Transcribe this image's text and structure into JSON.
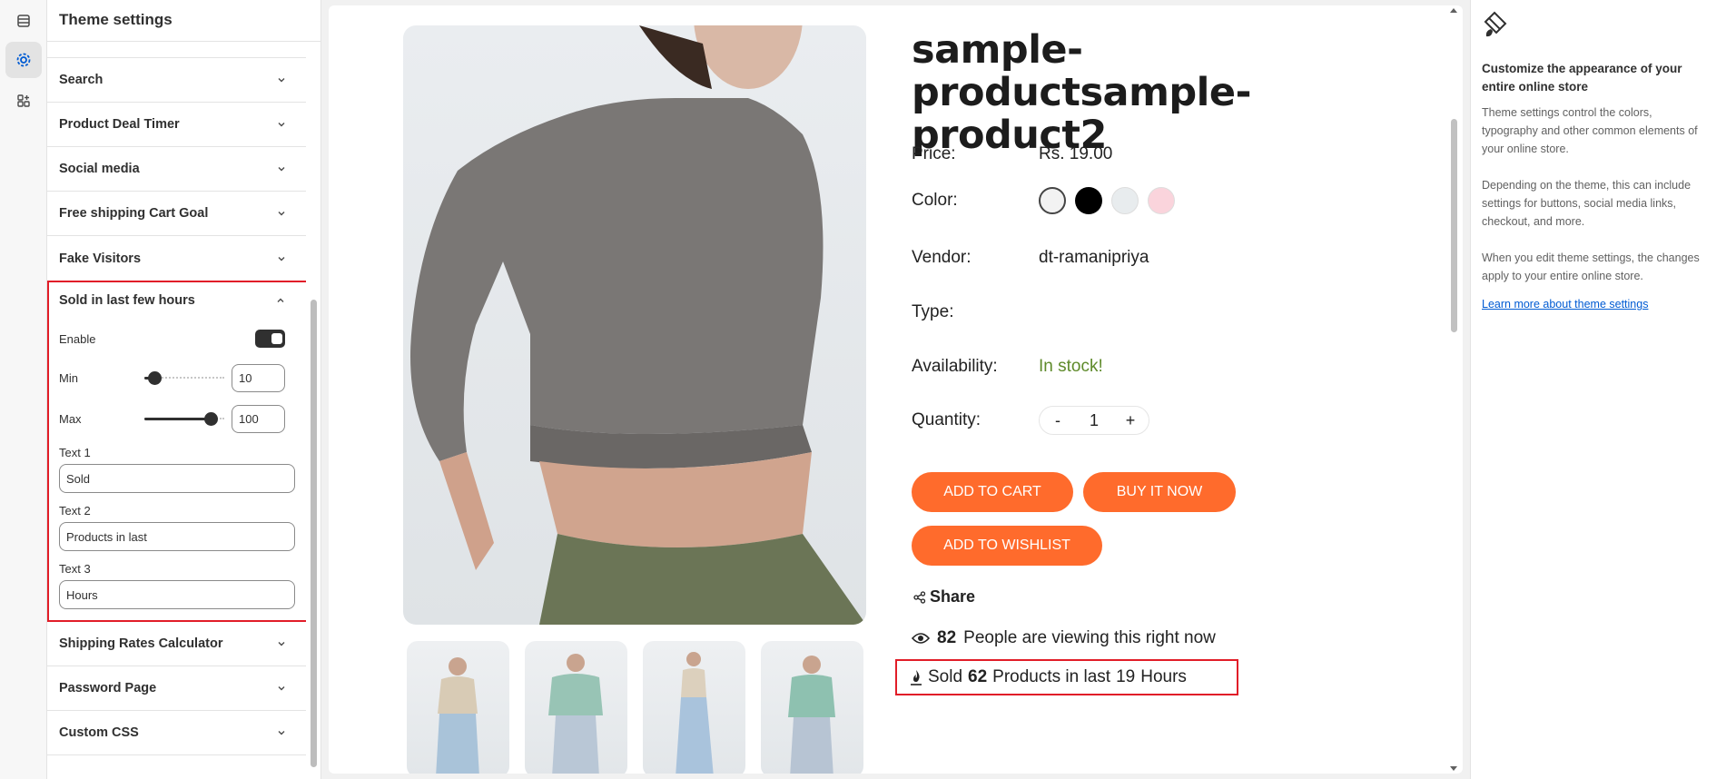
{
  "panel": {
    "title": "Theme settings",
    "collapsed_top": [
      "Search",
      "Product Deal Timer",
      "Social media",
      "Free shipping Cart Goal",
      "Fake Visitors"
    ],
    "expanded": {
      "title": "Sold in last few hours",
      "enable_label": "Enable",
      "enabled": true,
      "min_label": "Min",
      "min_value": "10",
      "min_fraction": 0.05,
      "max_label": "Max",
      "max_value": "100",
      "max_fraction": 0.9,
      "text1_label": "Text 1",
      "text1_value": "Sold",
      "text2_label": "Text 2",
      "text2_value": "Products in last",
      "text3_label": "Text 3",
      "text3_value": "Hours"
    },
    "collapsed_bottom": [
      "Shipping Rates Calculator",
      "Password Page",
      "Custom CSS"
    ]
  },
  "product": {
    "title": "sample-productsample-product2",
    "price_label": "Price:",
    "price": "Rs. 19.00",
    "color_label": "Color:",
    "colors": [
      "#f2f2f2",
      "#000000",
      "#e8ecee",
      "#fad4dc"
    ],
    "vendor_label": "Vendor:",
    "vendor": "dt-ramanipriya",
    "type_label": "Type:",
    "availability_label": "Availability:",
    "availability": "In stock!",
    "availability_color": "#5e8a2a",
    "quantity_label": "Quantity:",
    "quantity_minus": "-",
    "quantity": "1",
    "quantity_plus": "+",
    "add_to_cart": "ADD TO CART",
    "buy_now": "BUY IT NOW",
    "add_to_wishlist": "ADD TO WISHLIST",
    "share": "Share",
    "viewers_count": "82",
    "viewers_text": "People are viewing this right now",
    "sold_prefix": "Sold",
    "sold_count": "62",
    "sold_middle": "Products in last",
    "sold_hours": "19",
    "sold_suffix": "Hours",
    "accent_color": "#ff6b2c"
  },
  "help": {
    "heading": "Customize the appearance of your entire online store",
    "p1": "Theme settings control the colors, typography and other common elements of your online store.",
    "p2": "Depending on the theme, this can include settings for buttons, social media links, checkout, and more.",
    "p3": "When you edit theme settings, the changes apply to your entire online store.",
    "link": "Learn more about theme settings"
  }
}
